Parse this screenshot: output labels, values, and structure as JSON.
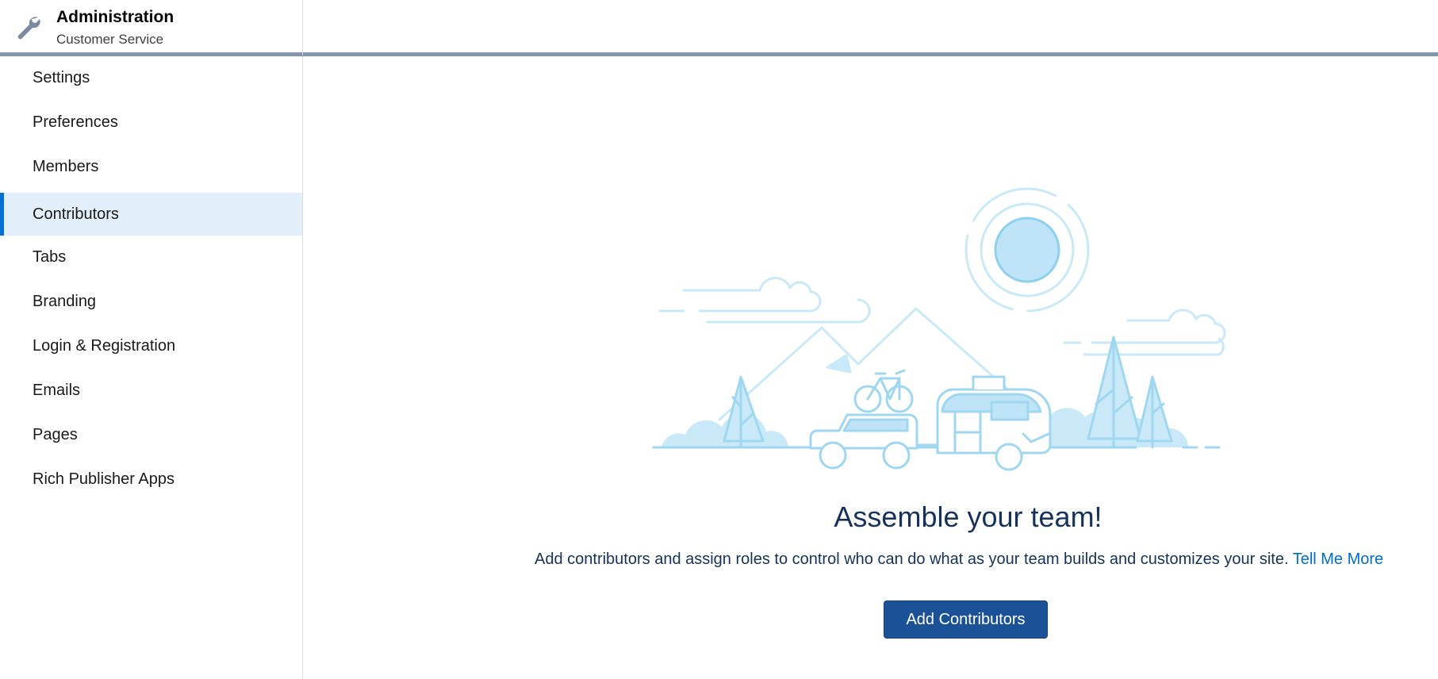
{
  "header": {
    "title": "Administration",
    "subtitle": "Customer Service",
    "icon": "wrench-icon"
  },
  "sidebar": {
    "items": [
      {
        "label": "Settings",
        "active": false
      },
      {
        "label": "Preferences",
        "active": false
      },
      {
        "label": "Members",
        "active": false
      },
      {
        "label": "Contributors",
        "active": true
      },
      {
        "label": "Tabs",
        "active": false
      },
      {
        "label": "Branding",
        "active": false
      },
      {
        "label": "Login & Registration",
        "active": false
      },
      {
        "label": "Emails",
        "active": false
      },
      {
        "label": "Pages",
        "active": false
      },
      {
        "label": "Rich Publisher Apps",
        "active": false
      }
    ]
  },
  "main": {
    "headline": "Assemble your team!",
    "description": "Add contributors and assign roles to control who can do what as your team builds and customizes your site.",
    "link": "Tell Me More",
    "button": "Add Contributors"
  },
  "colors": {
    "accent": "#0070d2",
    "button": "#1b5297",
    "active_bg": "#e3eefb",
    "header_border": "#8396ad",
    "illustration": "#9fd6f0"
  }
}
